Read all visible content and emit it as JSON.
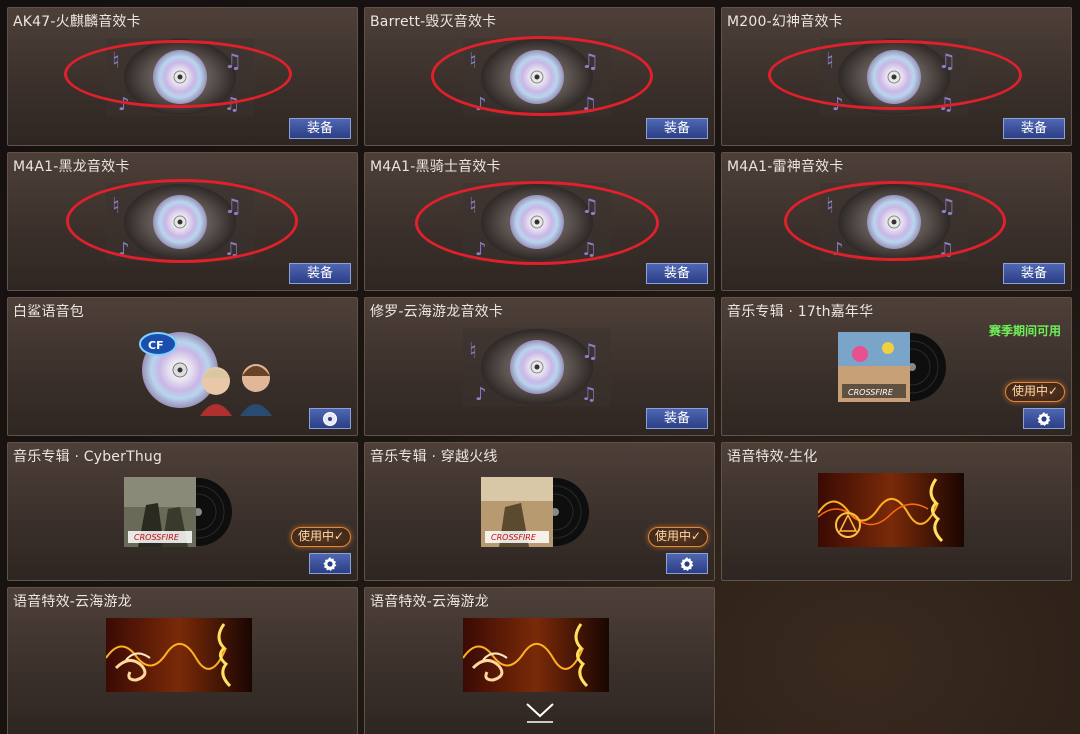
{
  "items": [
    {
      "title": "AK47-火麒麟音效卡",
      "type": "sound_card",
      "button": "装备",
      "highlighted": true
    },
    {
      "title": "Barrett-毁灭音效卡",
      "type": "sound_card",
      "button": "装备",
      "highlighted": true
    },
    {
      "title": "M200-幻神音效卡",
      "type": "sound_card",
      "button": "装备",
      "highlighted": true
    },
    {
      "title": "M4A1-黑龙音效卡",
      "type": "sound_card",
      "button": "装备",
      "highlighted": true
    },
    {
      "title": "M4A1-黑骑士音效卡",
      "type": "sound_card",
      "button": "装备",
      "highlighted": true
    },
    {
      "title": "M4A1-雷神音效卡",
      "type": "sound_card",
      "button": "装备",
      "highlighted": true
    },
    {
      "title": "白鲨语音包",
      "type": "voice_pack",
      "button_icon": "disc-icon"
    },
    {
      "title": "修罗-云海游龙音效卡",
      "type": "sound_card",
      "button": "装备",
      "highlighted": false
    },
    {
      "title": "音乐专辑 · 17th嘉年华",
      "type": "album",
      "status": "使用中✓",
      "season_note": "赛季期间可用",
      "button_icon": "gear-icon"
    },
    {
      "title": "音乐专辑 · CyberThug",
      "type": "album",
      "status": "使用中✓",
      "button_icon": "gear-icon"
    },
    {
      "title": "音乐专辑 · 穿越火线",
      "type": "album",
      "status": "使用中✓",
      "button_icon": "gear-icon"
    },
    {
      "title": "语音特效-生化",
      "type": "voice_effect"
    },
    {
      "title": "语音特效-云海游龙",
      "type": "voice_effect"
    },
    {
      "title": "语音特效-云海游龙",
      "type": "voice_effect"
    }
  ],
  "colors": {
    "highlight": "#e0202a",
    "button": "#2c3f86",
    "in_use_border": "#e08a3a",
    "season_text": "#6ff05a"
  },
  "scroll_icon": "chevron-down-icon"
}
